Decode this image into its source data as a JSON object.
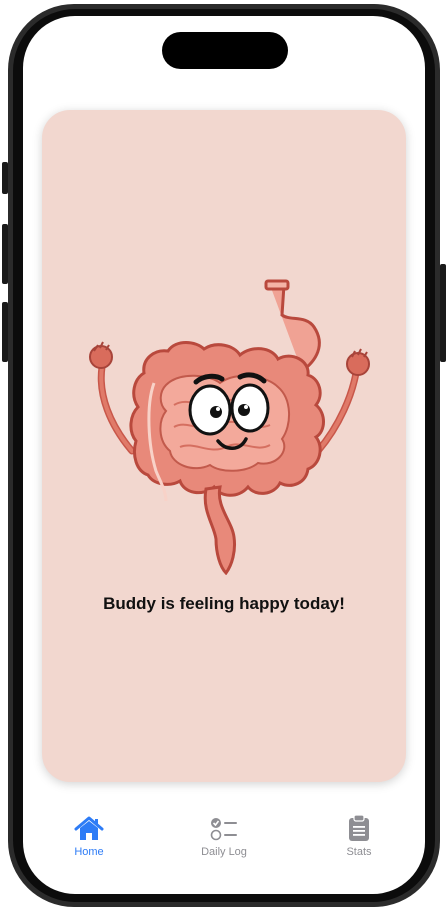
{
  "card": {
    "status_message": "Buddy is feeling happy today!",
    "mascot_icon": "happy-intestines-mascot",
    "background_color": "#f2d7cf"
  },
  "tabbar": {
    "active_color": "#2e7cf6",
    "inactive_color": "#8e8e93",
    "tabs": [
      {
        "label": "Home",
        "icon": "house-icon",
        "active": true
      },
      {
        "label": "Daily Log",
        "icon": "checklist-icon",
        "active": false
      },
      {
        "label": "Stats",
        "icon": "clipboard-icon",
        "active": false
      }
    ]
  }
}
